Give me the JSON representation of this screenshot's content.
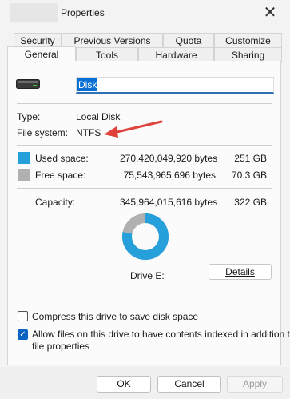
{
  "window": {
    "title": "Properties",
    "close_glyph": "✕"
  },
  "tabs": {
    "row_top": [
      "Security",
      "Previous Versions",
      "Quota",
      "Customize"
    ],
    "row_bottom": [
      "General",
      "Tools",
      "Hardware",
      "Sharing"
    ],
    "active": "General"
  },
  "general": {
    "drive_name": "Disk",
    "type_label": "Type:",
    "type_value": "Local Disk",
    "fs_label": "File system:",
    "fs_value": "NTFS",
    "annotation": "red-arrow pointing to file system value"
  },
  "usage": {
    "used": {
      "label": "Used space:",
      "bytes": "270,420,049,920 bytes",
      "size": "251 GB",
      "color": "#26a0da"
    },
    "free": {
      "label": "Free space:",
      "bytes": "75,543,965,696 bytes",
      "size": "70.3 GB",
      "color": "#b0b0b0"
    },
    "capacity": {
      "label": "Capacity:",
      "bytes": "345,964,015,616 bytes",
      "size": "322 GB"
    },
    "used_fraction": 0.7816
  },
  "drive_label": "Drive E:",
  "details_button": {
    "label": "Details"
  },
  "options": {
    "compress": {
      "label": "Compress this drive to save disk space",
      "checked": false
    },
    "index_line1": "Allow files on this drive to have contents indexed in addition to",
    "index_line2": "file properties",
    "index_checked": true,
    "check_glyph": "✓"
  },
  "buttons": {
    "ok": "OK",
    "cancel": "Cancel",
    "apply": "Apply"
  }
}
